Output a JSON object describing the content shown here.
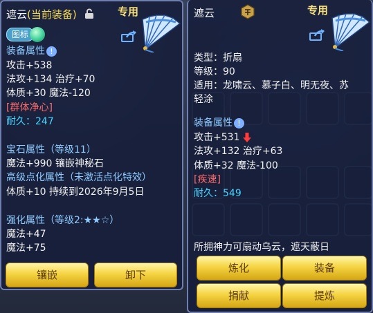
{
  "left": {
    "title": "遮云",
    "equipped_tag": "(当前装备)",
    "exclusive": "专用",
    "icon_badge": "图标",
    "equip_attr_label": "装备属性",
    "attack": "攻击+538",
    "magic_attack_heal": "法攻+134 治疗+70",
    "constitution_magic": "体质+30 魔法-120",
    "skill": "[群体净心]",
    "durability": "耐久：247",
    "gem_attr": "宝石属性（等级11）",
    "gem_detail": "魔法+990 镶嵌神秘石",
    "advanced_attr": "高级点化属性（未激活点化特效）",
    "advanced_detail": "体质+10 持续到2026年9月5日",
    "enhance_attr": "强化属性（等级2:★★☆）",
    "enhance_1": "魔法+47",
    "enhance_2": "魔法+75",
    "buttons": {
      "inlay": "镶嵌",
      "unequip": "卸下"
    }
  },
  "right": {
    "title": "遮云",
    "exclusive": "专用",
    "type": "类型：折扇",
    "level": "等级：90",
    "fit_label": "适用：龙啸云、慕子白、明无夜、苏",
    "fit_label_2": "轻涂",
    "equip_attr_label": "装备属性",
    "attack": "攻击+531",
    "magic_attack_heal": "法攻+132 治疗+63",
    "constitution_magic": "体质+32 魔法-100",
    "skill": "[疾速]",
    "durability": "耐久：549",
    "description": "所拥神力可扇动乌云，遮天蔽日",
    "buttons": {
      "refine": "炼化",
      "equip": "装备",
      "donate": "捐献",
      "extract": "提炼"
    }
  },
  "colors": {
    "accent_gold": "#f5d442",
    "panel": "#16203a",
    "cyan": "#46d4ff",
    "red": "#ff6a6a"
  }
}
